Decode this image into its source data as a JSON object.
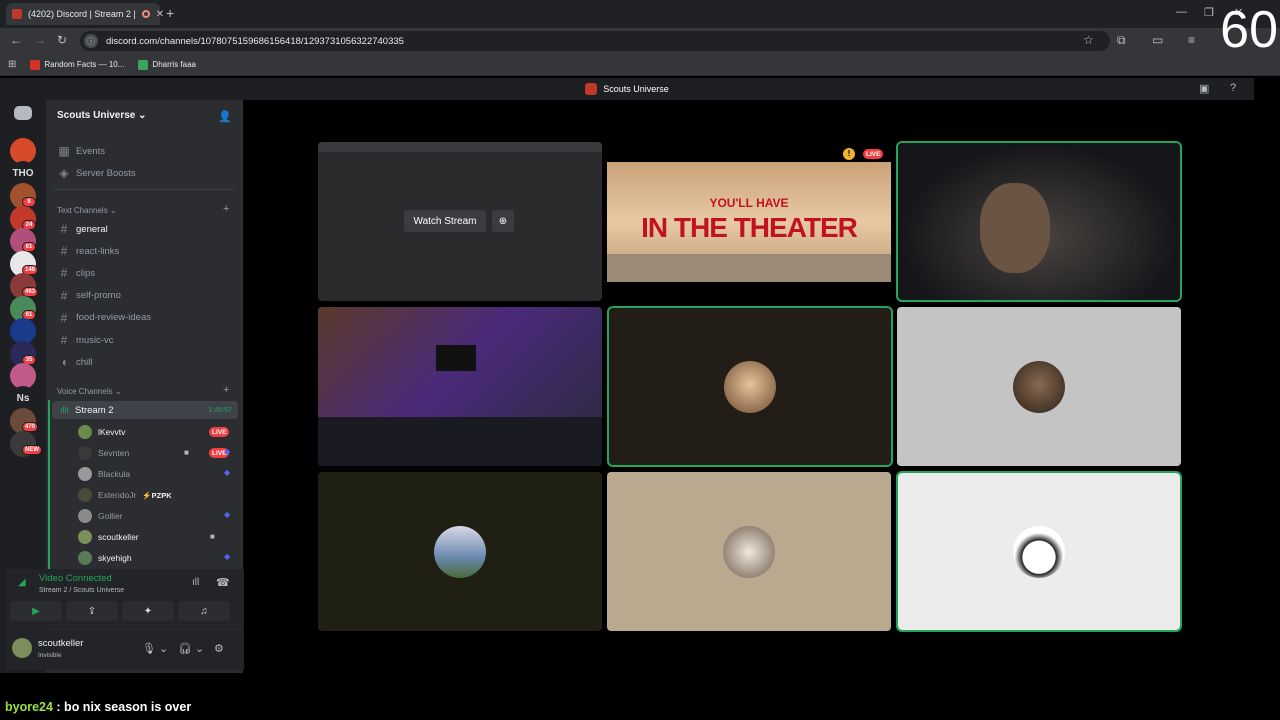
{
  "browser": {
    "tab_title": "(4202) Discord | Stream 2 |",
    "url": "discord.com/channels/1078075159686156418/1293731056322740335",
    "bookmarks": [
      "Random Facts — 10...",
      "Dharris faaa"
    ]
  },
  "overlay": {
    "fps": "60"
  },
  "discord": {
    "title": "Scouts Universe",
    "guild_icons": [
      {
        "label": "",
        "badge": ""
      },
      {
        "label": "THO",
        "badge": ""
      },
      {
        "label": "",
        "badge": "8"
      },
      {
        "label": "",
        "badge": "24"
      },
      {
        "label": "",
        "badge": "61"
      },
      {
        "label": "",
        "badge": "148"
      },
      {
        "label": "",
        "badge": "463"
      },
      {
        "label": "",
        "badge": "61"
      },
      {
        "label": "",
        "badge": ""
      },
      {
        "label": "",
        "badge": "35"
      },
      {
        "label": "",
        "badge": ""
      },
      {
        "label": "Ns",
        "badge": ""
      },
      {
        "label": "",
        "badge": "470"
      },
      {
        "label": "",
        "badge": "NEW"
      }
    ],
    "server_name": "Scouts Universe",
    "nav": {
      "events": "Events",
      "boosts": "Server Boosts"
    },
    "text_category": "Text Channels",
    "text_channels": [
      "general",
      "react-links",
      "clips",
      "self-promo",
      "food-review-ideas",
      "music-vc",
      "chill"
    ],
    "voice_category": "Voice Channels",
    "voice_channel": {
      "name": "Stream 2",
      "time": "1:46:57"
    },
    "members": [
      {
        "name": "lKevvtv",
        "live": "LIVE"
      },
      {
        "name": "Sevnten",
        "live": "LIVE"
      },
      {
        "name": "Blackula",
        "live": ""
      },
      {
        "name": "ExtendoJr",
        "tag": "⚡PZPK",
        "live": ""
      },
      {
        "name": "Gollier",
        "live": ""
      },
      {
        "name": "scoutkeller",
        "live": ""
      },
      {
        "name": "skyehigh",
        "live": ""
      }
    ],
    "voice_panel": {
      "status": "Video Connected",
      "sub": "Stream 2 / Scouts Universe"
    },
    "user": {
      "name": "scoutkeller",
      "status": "Invisible"
    },
    "stream": {
      "watch_label": "Watch Stream",
      "live_badge": "LIVE",
      "movie_line1": "YOU'LL HAVE",
      "movie_line2": "IN THE THEATER"
    }
  },
  "chat": {
    "user": "byore24",
    "message": " : bo nix season is over"
  }
}
